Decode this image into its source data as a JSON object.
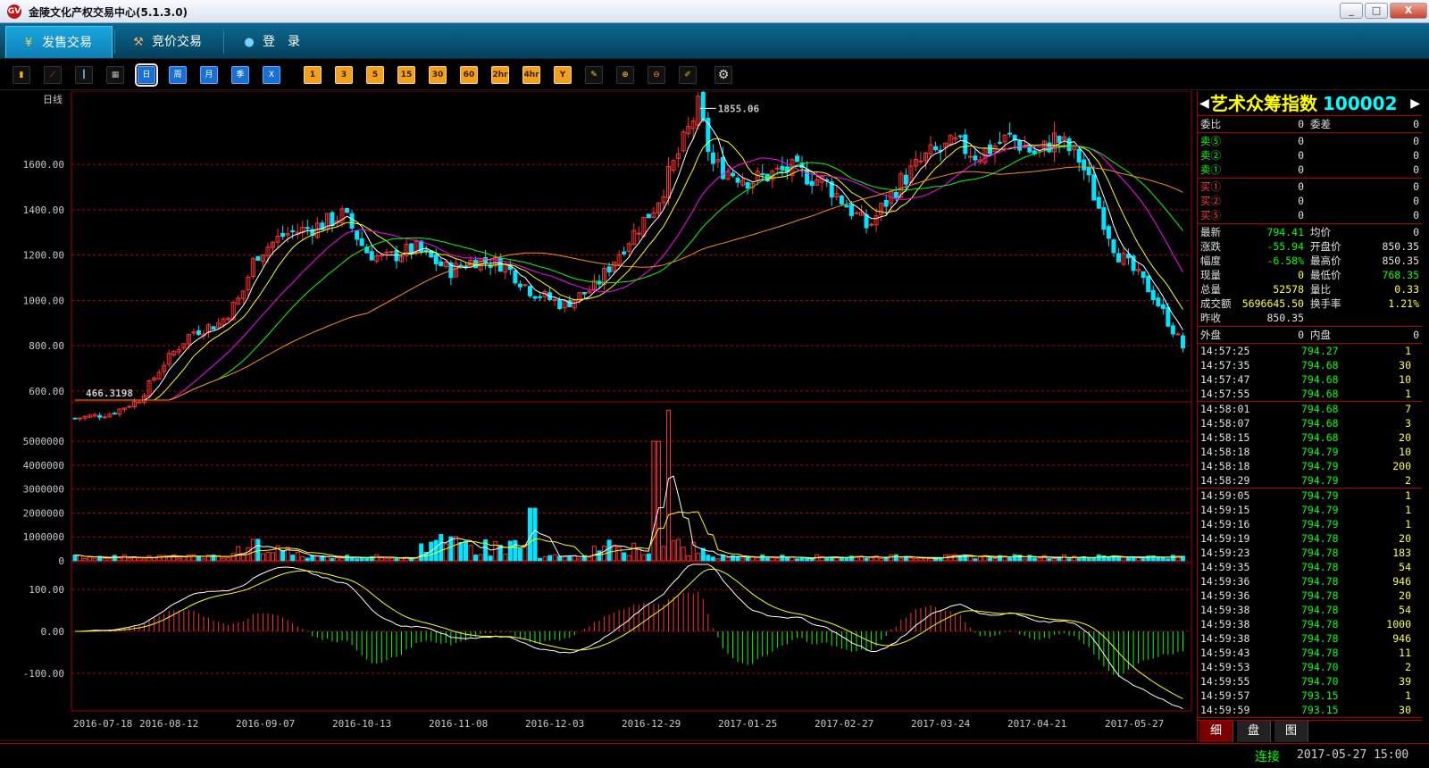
{
  "window": {
    "title": "金陵文化产权交易中心(5.1.3.0)",
    "logo_text": "GV",
    "minimize": "_",
    "maximize": "□",
    "close": "X"
  },
  "nav": {
    "tabs": [
      {
        "label": "发售交易",
        "icon": "yen-icon",
        "glyph": "¥",
        "active": true
      },
      {
        "label": "竞价交易",
        "icon": "gavel-icon",
        "glyph": "⚒",
        "active": false
      },
      {
        "label": "登　录",
        "icon": "user-icon",
        "glyph": "●",
        "active": false
      }
    ]
  },
  "toolbar": {
    "chart_icons": [
      "bar-chart-icon",
      "line-chart-icon",
      "candlestick-icon",
      "calendar-icon"
    ],
    "periods": [
      "日",
      "周",
      "月",
      "季",
      "X"
    ],
    "minutes": [
      "1",
      "3",
      "5",
      "15",
      "30",
      "60",
      "2hr",
      "4hr",
      "Y"
    ],
    "tool_icons": [
      "draw-icon",
      "zoom-in-icon",
      "zoom-out-icon",
      "pencil-icon",
      "settings-icon"
    ]
  },
  "chart_data": {
    "type": "candlestick",
    "period_label": "日线",
    "price": {
      "ylim": [
        560,
        1900
      ],
      "ticks": [
        "600.00",
        "800.00",
        "1000.00",
        "1200.00",
        "1400.00",
        "1600.00"
      ],
      "high_label": "1855.06",
      "low_label": "466.3198",
      "x_dates": [
        "2016-07-18",
        "2016-08-12",
        "2016-09-07",
        "2016-10-13",
        "2016-11-08",
        "2016-12-03",
        "2016-12-29",
        "2017-01-25",
        "2017-02-27",
        "2017-03-24",
        "2017-04-21",
        "2017-05-27"
      ],
      "close_path": [
        [
          "2016-07-18",
          480
        ],
        [
          "2016-07-28",
          500
        ],
        [
          "2016-08-05",
          560
        ],
        [
          "2016-08-12",
          720
        ],
        [
          "2016-08-20",
          860
        ],
        [
          "2016-08-28",
          900
        ],
        [
          "2016-09-03",
          1020
        ],
        [
          "2016-09-07",
          1200
        ],
        [
          "2016-09-15",
          1290
        ],
        [
          "2016-09-25",
          1330
        ],
        [
          "2016-10-02",
          1380
        ],
        [
          "2016-10-08",
          1220
        ],
        [
          "2016-10-13",
          1180
        ],
        [
          "2016-10-22",
          1230
        ],
        [
          "2016-11-01",
          1130
        ],
        [
          "2016-11-08",
          1180
        ],
        [
          "2016-11-16",
          1160
        ],
        [
          "2016-11-24",
          1040
        ],
        [
          "2016-12-03",
          980
        ],
        [
          "2016-12-12",
          1060
        ],
        [
          "2016-12-20",
          1240
        ],
        [
          "2016-12-29",
          1420
        ],
        [
          "2017-01-06",
          1700
        ],
        [
          "2017-01-10",
          1855
        ],
        [
          "2017-01-14",
          1600
        ],
        [
          "2017-01-25",
          1530
        ],
        [
          "2017-02-05",
          1580
        ],
        [
          "2017-02-15",
          1520
        ],
        [
          "2017-02-27",
          1320
        ],
        [
          "2017-03-08",
          1520
        ],
        [
          "2017-03-16",
          1640
        ],
        [
          "2017-03-24",
          1690
        ],
        [
          "2017-03-30",
          1640
        ],
        [
          "2017-04-08",
          1720
        ],
        [
          "2017-04-16",
          1640
        ],
        [
          "2017-04-21",
          1720
        ],
        [
          "2017-04-28",
          1620
        ],
        [
          "2017-05-08",
          1220
        ],
        [
          "2017-05-18",
          1040
        ],
        [
          "2017-05-27",
          794
        ]
      ]
    },
    "volume": {
      "ticks": [
        "0",
        "1000000",
        "2000000",
        "3000000",
        "4000000",
        "5000000"
      ],
      "spikes": [
        [
          "2016-09-07",
          900000
        ],
        [
          "2016-11-24",
          2200000
        ],
        [
          "2016-12-29",
          5000000
        ],
        [
          "2017-01-01",
          6300000
        ]
      ]
    },
    "macd": {
      "ticks": [
        "100.00",
        "0.00",
        "-100.00"
      ]
    }
  },
  "panel": {
    "title": "艺术众筹指数",
    "code": "100002",
    "wei": [
      {
        "l1": "委比",
        "v1": "0",
        "l2": "委差",
        "v2": "0"
      }
    ],
    "sell": [
      {
        "label": "卖⑤",
        "price": "0",
        "vol": "0"
      },
      {
        "label": "卖②",
        "price": "0",
        "vol": "0"
      },
      {
        "label": "卖①",
        "price": "0",
        "vol": "0"
      }
    ],
    "buy": [
      {
        "label": "买①",
        "price": "0",
        "vol": "0"
      },
      {
        "label": "买②",
        "price": "0",
        "vol": "0"
      },
      {
        "label": "买⑤",
        "price": "0",
        "vol": "0"
      }
    ],
    "quote": [
      {
        "l1": "最新",
        "v1": "794.41",
        "c1": "g",
        "l2": "均价",
        "v2": "0",
        "c2": "w"
      },
      {
        "l1": "涨跌",
        "v1": "-55.94",
        "c1": "g",
        "l2": "开盘价",
        "v2": "850.35",
        "c2": "w"
      },
      {
        "l1": "幅度",
        "v1": "-6.58%",
        "c1": "g",
        "l2": "最高价",
        "v2": "850.35",
        "c2": "w"
      },
      {
        "l1": "现量",
        "v1": "0",
        "c1": "y",
        "l2": "最低价",
        "v2": "768.35",
        "c2": "g"
      },
      {
        "l1": "总量",
        "v1": "52578",
        "c1": "y",
        "l2": "量比",
        "v2": "0.33",
        "c2": "y"
      },
      {
        "l1": "成交额",
        "v1": "5696645.50",
        "c1": "y",
        "l2": "换手率",
        "v2": "1.21%",
        "c2": "y"
      },
      {
        "l1": "昨收",
        "v1": "850.35",
        "c1": "w",
        "l2": "",
        "v2": "",
        "c2": "w"
      }
    ],
    "outer": [
      {
        "l1": "外盘",
        "v1": "0",
        "l2": "内盘",
        "v2": "0"
      }
    ],
    "ticks": [
      [
        {
          "time": "14:57:25",
          "price": "794.27",
          "vol": "1"
        },
        {
          "time": "14:57:35",
          "price": "794.68",
          "vol": "30"
        },
        {
          "time": "14:57:47",
          "price": "794.68",
          "vol": "10"
        },
        {
          "time": "14:57:55",
          "price": "794.68",
          "vol": "1"
        }
      ],
      [
        {
          "time": "14:58:01",
          "price": "794.68",
          "vol": "7"
        },
        {
          "time": "14:58:07",
          "price": "794.68",
          "vol": "3"
        },
        {
          "time": "14:58:15",
          "price": "794.68",
          "vol": "20"
        },
        {
          "time": "14:58:18",
          "price": "794.79",
          "vol": "10"
        },
        {
          "time": "14:58:18",
          "price": "794.79",
          "vol": "200"
        },
        {
          "time": "14:58:29",
          "price": "794.79",
          "vol": "2"
        }
      ],
      [
        {
          "time": "14:59:05",
          "price": "794.79",
          "vol": "1"
        },
        {
          "time": "14:59:15",
          "price": "794.79",
          "vol": "1"
        },
        {
          "time": "14:59:16",
          "price": "794.79",
          "vol": "1"
        },
        {
          "time": "14:59:19",
          "price": "794.78",
          "vol": "20"
        },
        {
          "time": "14:59:23",
          "price": "794.78",
          "vol": "183"
        },
        {
          "time": "14:59:35",
          "price": "794.78",
          "vol": "54"
        },
        {
          "time": "14:59:36",
          "price": "794.78",
          "vol": "946"
        },
        {
          "time": "14:59:36",
          "price": "794.78",
          "vol": "20"
        },
        {
          "time": "14:59:38",
          "price": "794.78",
          "vol": "54"
        },
        {
          "time": "14:59:38",
          "price": "794.78",
          "vol": "1000"
        },
        {
          "time": "14:59:38",
          "price": "794.78",
          "vol": "946"
        },
        {
          "time": "14:59:43",
          "price": "794.78",
          "vol": "11"
        },
        {
          "time": "14:59:53",
          "price": "794.70",
          "vol": "2"
        },
        {
          "time": "14:59:55",
          "price": "794.70",
          "vol": "39"
        },
        {
          "time": "14:59:57",
          "price": "793.15",
          "vol": "1"
        },
        {
          "time": "14:59:59",
          "price": "793.15",
          "vol": "30"
        }
      ]
    ],
    "tabs": [
      "细",
      "盘",
      "图"
    ]
  },
  "status": {
    "connection": "连接",
    "datetime": "2017-05-27 15:00"
  }
}
